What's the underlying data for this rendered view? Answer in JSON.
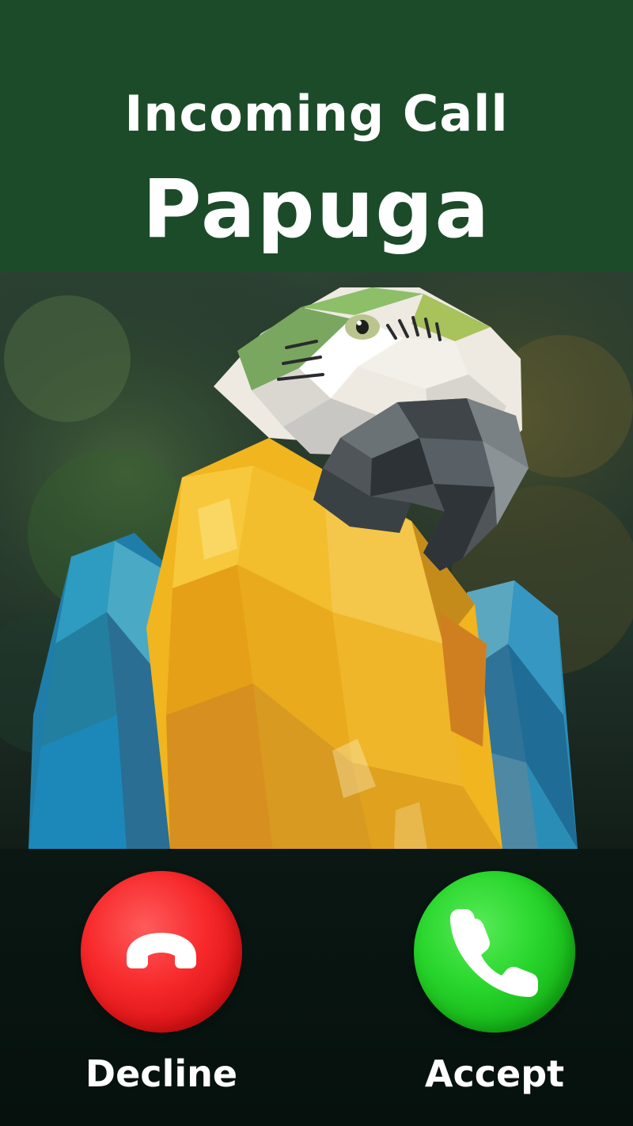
{
  "header": {
    "label": "Incoming Call",
    "caller_name": "Papuga"
  },
  "caller_photo": {
    "subject": "polygonal macaw portrait",
    "dominant_colors": {
      "background": "#1f3528",
      "plumage_blue": "#2b8fb2",
      "plumage_yellow": "#f1b71f",
      "face_white": "#ece7dc",
      "beak_gray": "#4d5458"
    }
  },
  "actions": {
    "decline": {
      "label": "Decline",
      "icon": "phone-hangup-icon",
      "color": "#f22b2b"
    },
    "accept": {
      "label": "Accept",
      "icon": "phone-icon",
      "color": "#20c824"
    }
  }
}
